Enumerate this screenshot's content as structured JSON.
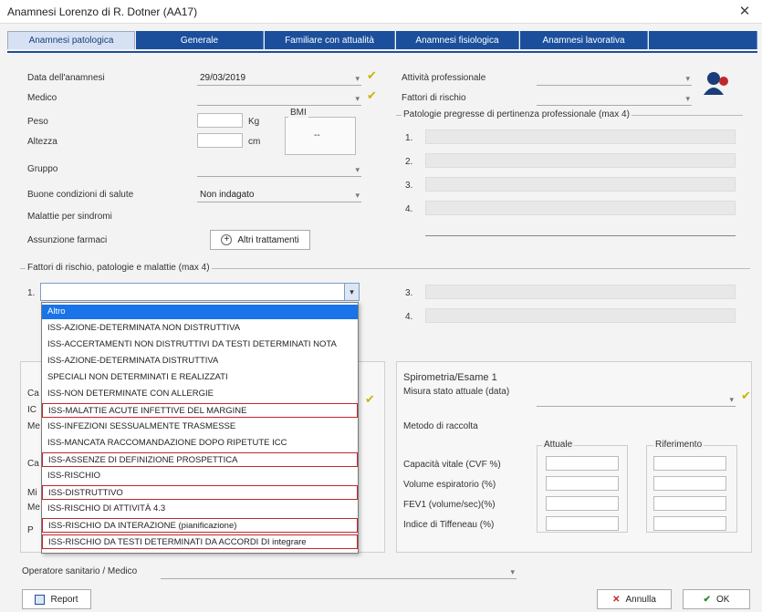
{
  "window": {
    "title": "Anamnesi Lorenzo di R. Dotner (AA17)"
  },
  "tabs": [
    {
      "label": "Anamnesi patologica"
    },
    {
      "label": "Generale"
    },
    {
      "label": "Familiare con attualità"
    },
    {
      "label": "Anamnesi fisiologica"
    },
    {
      "label": "Anamnesi lavorativa"
    }
  ],
  "form": {
    "data_anamnesi_label": "Data dell'anamnesi",
    "data_anamnesi_value": "29/03/2019",
    "medico_label": "Medico",
    "peso_label": "Peso",
    "peso_unit": "Kg",
    "altezza_label": "Altezza",
    "altezza_unit": "cm",
    "bmi_label": "BMI",
    "bmi_value": "--",
    "gruppo_label": "Gruppo",
    "buone_label": "Buone condizioni di salute",
    "buone_value": "Non indagato",
    "malattie_label": "Malattie per sindromi",
    "malattie_btn": "Altri trattamenti",
    "assunto_label": "Assunzione farmaci",
    "attivita_label": "Attività professionale",
    "fattori_label": "Fattori di rischio",
    "altri_group": "Patologie pregresse di pertinenza professionale (max 4)",
    "row_nums": [
      "1.",
      "2.",
      "3.",
      "4."
    ]
  },
  "left_group": {
    "title": "Fattori di rischio, patologie e malattie (max 4)",
    "field1_num": "1.",
    "field3_num": "3.",
    "field4_num": "4."
  },
  "dropdown_options": [
    {
      "text": "Altro",
      "selected": true,
      "boxed": false
    },
    {
      "text": "ISS-AZIONE-DETERMINATA NON DISTRUTTIVA",
      "selected": false,
      "boxed": false
    },
    {
      "text": "ISS-ACCERTAMENTI NON DISTRUTTIVI DA TESTI DETERMINATI NOTA",
      "selected": false,
      "boxed": false
    },
    {
      "text": "ISS-AZIONE-DETERMINATA DISTRUTTIVA",
      "selected": false,
      "boxed": false
    },
    {
      "text": "SPECIALI NON DETERMINATI E REALIZZATI",
      "selected": false,
      "boxed": false
    },
    {
      "text": "ISS-NON DETERMINATE CON ALLERGIE",
      "selected": false,
      "boxed": false
    },
    {
      "text": "ISS-MALATTIE ACUTE INFETTIVE DEL MARGINE",
      "selected": false,
      "boxed": true
    },
    {
      "text": "ISS-INFEZIONI SESSUALMENTE TRASMESSE",
      "selected": false,
      "boxed": false
    },
    {
      "text": "ISS-MANCATA RACCOMANDAZIONE DOPO RIPETUTE ICC",
      "selected": false,
      "boxed": false
    },
    {
      "text": "ISS-ASSENZE DI DEFINIZIONE PROSPETTICA",
      "selected": false,
      "boxed": true
    },
    {
      "text": "ISS-RISCHIO",
      "selected": false,
      "boxed": false
    },
    {
      "text": "ISS-DISTRUTTIVO",
      "selected": false,
      "boxed": true
    },
    {
      "text": "ISS-RISCHIO DI ATTIVITÀ 4.3",
      "selected": false,
      "boxed": false
    },
    {
      "text": "ISS-RISCHIO DA INTERAZIONE (pianificazione)",
      "selected": false,
      "boxed": true
    },
    {
      "text": "ISS-RISCHIO DA TESTI DETERMINATI DA ACCORDI DI integrare",
      "selected": false,
      "boxed": true
    }
  ],
  "lower_left": {
    "labels": [
      "Ca",
      "IC",
      "Me",
      "Ca",
      "Mi",
      "Me",
      "P"
    ]
  },
  "spirometria": {
    "title": "Spirometria/Esame 1",
    "misura_label": "Misura stato attuale (data)",
    "metodo_label": "Metodo di raccolta",
    "col1": "Attuale",
    "col2": "Riferimento",
    "rows": [
      "Capacità vitale (CVF %)",
      "Volume espiratorio (%)",
      "FEV1 (volume/sec)(%)",
      "Indice di Tiffeneau (%)"
    ]
  },
  "bottom": {
    "combo_label": "Operatore sanitario / Medico",
    "report_btn": "Report",
    "annulla_btn": "Annulla",
    "ok_btn": "OK"
  }
}
